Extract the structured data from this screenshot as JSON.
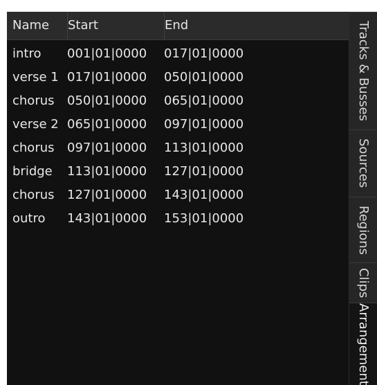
{
  "table": {
    "headers": {
      "name": "Name",
      "start": "Start",
      "end": "End"
    },
    "rows": [
      {
        "name": "intro",
        "start": "001|01|0000",
        "end": "017|01|0000"
      },
      {
        "name": "verse 1",
        "start": "017|01|0000",
        "end": "050|01|0000"
      },
      {
        "name": "chorus",
        "start": "050|01|0000",
        "end": "065|01|0000"
      },
      {
        "name": "verse 2",
        "start": "065|01|0000",
        "end": "097|01|0000"
      },
      {
        "name": "chorus",
        "start": "097|01|0000",
        "end": "113|01|0000"
      },
      {
        "name": "bridge",
        "start": "113|01|0000",
        "end": "127|01|0000"
      },
      {
        "name": "chorus",
        "start": "127|01|0000",
        "end": "143|01|0000"
      },
      {
        "name": "outro",
        "start": "143|01|0000",
        "end": "153|01|0000"
      }
    ]
  },
  "side_tabs": [
    {
      "label": "Tracks & Busses",
      "active": false
    },
    {
      "label": "Sources",
      "active": false
    },
    {
      "label": "Regions",
      "active": false
    },
    {
      "label": "Clips",
      "active": false
    },
    {
      "label": "Arrangement",
      "active": true
    }
  ]
}
